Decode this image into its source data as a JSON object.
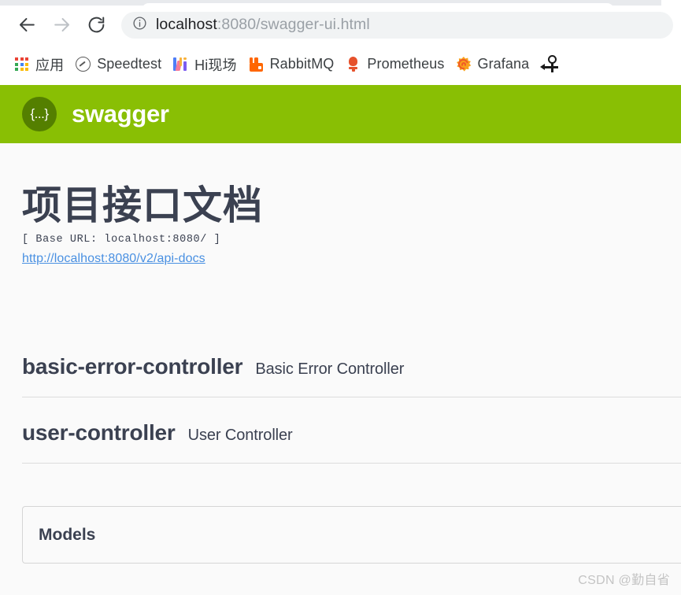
{
  "browser": {
    "nav": {
      "back_label": "Back",
      "forward_label": "Forward",
      "reload_label": "Reload"
    },
    "omnibox": {
      "site_info_icon": "info-circle-icon",
      "url_host": "localhost",
      "url_path": ":8080/swagger-ui.html",
      "full_url": "localhost:8080/swagger-ui.html"
    },
    "bookmarks": [
      {
        "label": "应用",
        "icon": "apps-grid-icon"
      },
      {
        "label": "Speedtest",
        "icon": "speedometer-icon"
      },
      {
        "label": "Hi现场",
        "icon": "hixianchang-icon"
      },
      {
        "label": "RabbitMQ",
        "icon": "rabbitmq-icon"
      },
      {
        "label": "Prometheus",
        "icon": "prometheus-torch-icon"
      },
      {
        "label": "Grafana",
        "icon": "grafana-sun-icon"
      },
      {
        "label": "",
        "icon": "key-pin-icon"
      }
    ]
  },
  "swagger": {
    "header": {
      "logo_glyph": "{...}",
      "wordmark": "swagger",
      "bar_color": "#89bf04",
      "logo_circle_color": "#547f00"
    },
    "info": {
      "title": "项目接口文档",
      "base_url": "[ Base URL: localhost:8080/ ]",
      "docs_link": "http://localhost:8080/v2/api-docs",
      "link_color": "#4990e2"
    },
    "tags": [
      {
        "name": "basic-error-controller",
        "description": "Basic Error Controller"
      },
      {
        "name": "user-controller",
        "description": "User Controller"
      }
    ],
    "models": {
      "title": "Models"
    }
  },
  "watermark": "CSDN @勤自省"
}
